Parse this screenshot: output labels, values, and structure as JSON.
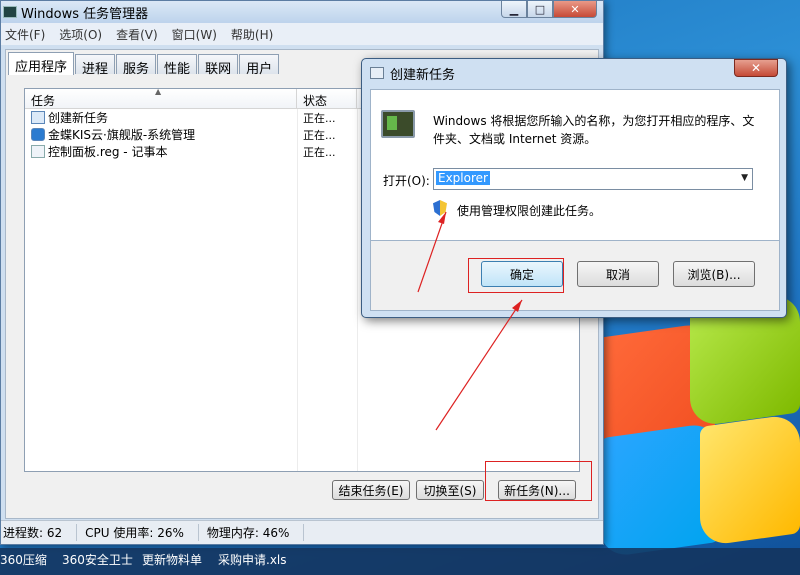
{
  "task_manager": {
    "title": "Windows 任务管理器",
    "menu": [
      "文件(F)",
      "选项(O)",
      "查看(V)",
      "窗口(W)",
      "帮助(H)"
    ],
    "tabs": [
      "应用程序",
      "进程",
      "服务",
      "性能",
      "联网",
      "用户"
    ],
    "columns": {
      "task": "任务",
      "status": "状态"
    },
    "rows": [
      {
        "name": "创建新任务",
        "status": "正在...",
        "icon": "run-dialog-icon"
      },
      {
        "name": "金蝶KIS云·旗舰版-系统管理",
        "status": "正在...",
        "icon": "kingdee-icon"
      },
      {
        "name": "控制面板.reg - 记事本",
        "status": "正在...",
        "icon": "notepad-icon"
      }
    ],
    "buttons": {
      "end_task": "结束任务(E)",
      "switch_to": "切换至(S)",
      "new_task": "新任务(N)..."
    },
    "status": {
      "processes": "进程数: 62",
      "cpu": "CPU 使用率: 26%",
      "memory": "物理内存: 46%"
    }
  },
  "taskbar_items": [
    "360压缩",
    "360安全卫士",
    "更新物料单",
    "采购申请.xls"
  ],
  "run_dialog": {
    "title": "创建新任务",
    "description": "Windows 将根据您所输入的名称，为您打开相应的程序、文件夹、文档或 Internet 资源。",
    "open_label": "打开(O):",
    "open_value": "Explorer",
    "admin_text": "使用管理权限创建此任务。",
    "buttons": {
      "ok": "确定",
      "cancel": "取消",
      "browse": "浏览(B)..."
    }
  },
  "annotation_color": "#d22222"
}
